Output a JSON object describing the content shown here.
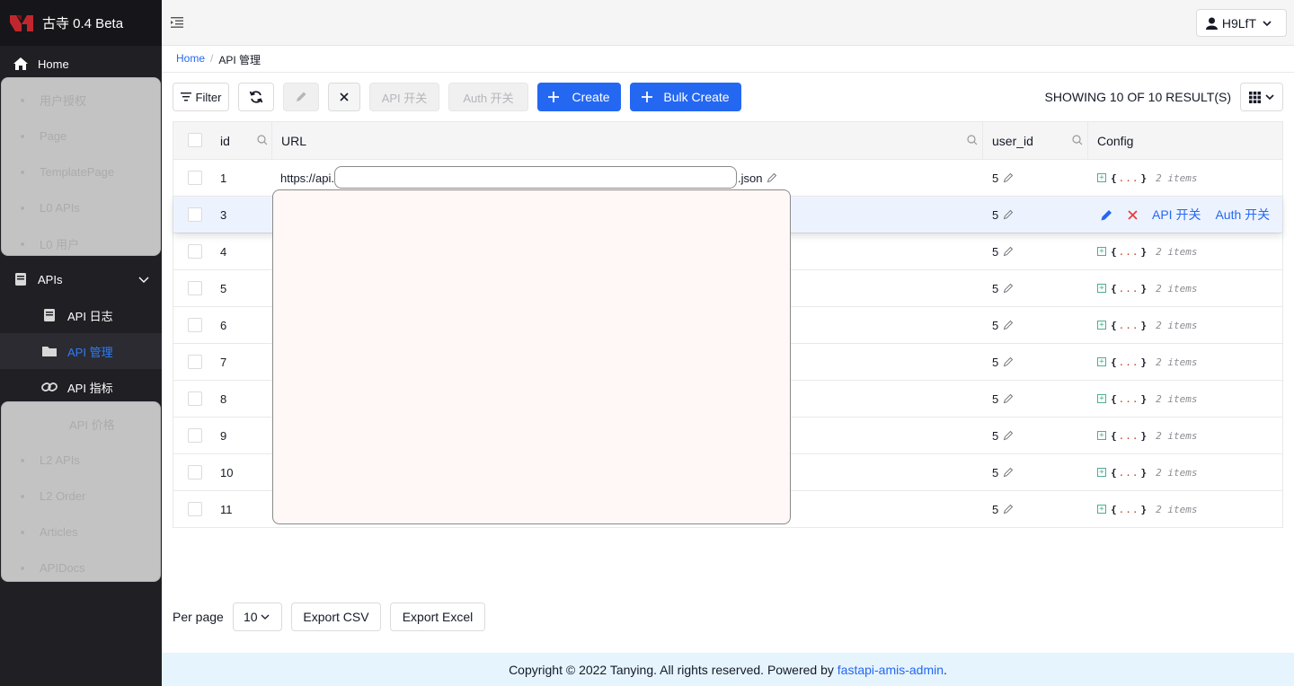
{
  "app": {
    "title": "古寺 0.4 Beta"
  },
  "sidebar": {
    "home": "Home",
    "hidden_top": [
      "用户授权",
      "Page",
      "TemplatePage",
      "L0 APIs",
      "L0 用户"
    ],
    "apis_group": "APIs",
    "apis_children": [
      {
        "label": "API 日志",
        "icon": "book-icon"
      },
      {
        "label": "API 管理",
        "icon": "folder-icon",
        "active": true
      },
      {
        "label": "API 指标",
        "icon": "link-icon"
      }
    ],
    "hidden_bottom": [
      "API 价格",
      "L2 APIs",
      "L2 Order",
      "Articles",
      "APIDocs"
    ]
  },
  "header": {
    "user": "H9LfT"
  },
  "breadcrumb": {
    "home": "Home",
    "current": "API 管理"
  },
  "toolbar": {
    "filter": "Filter",
    "api_switch": "API 开关",
    "auth_switch": "Auth 开关",
    "create": "Create",
    "bulk_create": "Bulk Create",
    "result": "SHOWING 10 OF 10 RESULT(S)"
  },
  "table": {
    "columns": {
      "id": "id",
      "url": "URL",
      "user_id": "user_id",
      "config": "Config"
    },
    "rows": [
      {
        "id": "1",
        "url_start": "https://api.",
        "url_end": ".json",
        "user_id": "5"
      },
      {
        "id": "3",
        "user_id": "5"
      },
      {
        "id": "4",
        "user_id": "5"
      },
      {
        "id": "5",
        "user_id": "5"
      },
      {
        "id": "6",
        "user_id": "5"
      },
      {
        "id": "7",
        "user_id": "5"
      },
      {
        "id": "8",
        "user_id": "5"
      },
      {
        "id": "9",
        "user_id": "5"
      },
      {
        "id": "10",
        "user_id": "5"
      },
      {
        "id": "11",
        "user_id": "5"
      }
    ],
    "config_open": "{",
    "config_dots": "...",
    "config_close": "}",
    "config_count": "2 items",
    "row_actions": {
      "api_switch": "API 开关",
      "auth_switch": "Auth 开关"
    }
  },
  "pagination": {
    "per_page_label": "Per page",
    "per_page": "10",
    "export_csv": "Export CSV",
    "export_excel": "Export Excel"
  },
  "footer": {
    "text": "Copyright © 2022 Tanying. All rights reserved. Powered by ",
    "link": "fastapi-amis-admin",
    "end": "."
  },
  "colors": {
    "primary": "#2468f2",
    "sidebar_bg": "#1f1f24",
    "footer_bg": "#e6f4fd",
    "danger": "#e93d3d"
  }
}
